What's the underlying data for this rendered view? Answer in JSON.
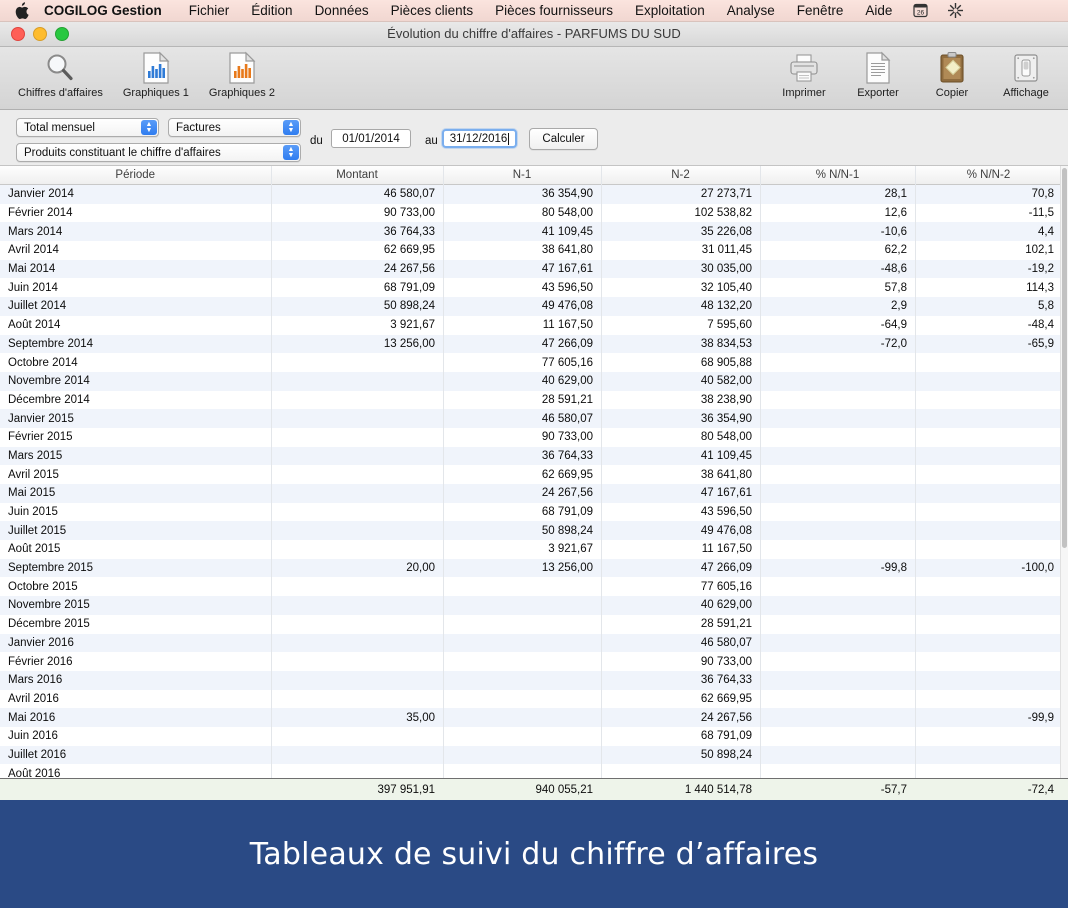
{
  "menubar": {
    "apple_icon": "apple-logo-icon",
    "app_name": "COGILOG Gestion",
    "items": [
      "Fichier",
      "Édition",
      "Données",
      "Pièces clients",
      "Pièces fournisseurs",
      "Exploitation",
      "Analyse",
      "Fenêtre",
      "Aide"
    ],
    "right_icons": [
      "calendar-26-icon",
      "gear-snowflake-icon"
    ]
  },
  "window": {
    "title": "Évolution du chiffre d'affaires - PARFUMS DU SUD",
    "traffic_lights": [
      "close-button",
      "minimize-button",
      "zoom-button"
    ]
  },
  "toolbar": {
    "left": [
      {
        "label": "Chiffres d'affaires",
        "icon": "magnifier-icon"
      },
      {
        "label": "Graphiques 1",
        "icon": "bar-chart-document-blue-icon"
      },
      {
        "label": "Graphiques 2",
        "icon": "bar-chart-document-orange-icon"
      }
    ],
    "right": [
      {
        "label": "Imprimer",
        "icon": "printer-icon"
      },
      {
        "label": "Exporter",
        "icon": "export-document-icon"
      },
      {
        "label": "Copier",
        "icon": "clipboard-icon"
      },
      {
        "label": "Affichage",
        "icon": "display-switch-icon"
      }
    ]
  },
  "filters": {
    "period_select": "Total mensuel",
    "doc_select": "Factures",
    "scope_select": "Produits constituant le chiffre d'affaires",
    "from_label": "du",
    "to_label": "au",
    "date_from": "01/01/2014",
    "date_to": "31/12/2016",
    "calculate_button": "Calculer"
  },
  "table": {
    "columns": [
      "Période",
      "Montant",
      "N-1",
      "N-2",
      "% N/N-1",
      "% N/N-2"
    ],
    "rows": [
      [
        "Janvier 2014",
        "46 580,07",
        "36 354,90",
        "27 273,71",
        "28,1",
        "70,8"
      ],
      [
        "Février 2014",
        "90 733,00",
        "80 548,00",
        "102 538,82",
        "12,6",
        "-11,5"
      ],
      [
        "Mars 2014",
        "36 764,33",
        "41 109,45",
        "35 226,08",
        "-10,6",
        "4,4"
      ],
      [
        "Avril 2014",
        "62 669,95",
        "38 641,80",
        "31 011,45",
        "62,2",
        "102,1"
      ],
      [
        "Mai 2014",
        "24 267,56",
        "47 167,61",
        "30 035,00",
        "-48,6",
        "-19,2"
      ],
      [
        "Juin 2014",
        "68 791,09",
        "43 596,50",
        "32 105,40",
        "57,8",
        "114,3"
      ],
      [
        "Juillet 2014",
        "50 898,24",
        "49 476,08",
        "48 132,20",
        "2,9",
        "5,8"
      ],
      [
        "Août 2014",
        "3 921,67",
        "11 167,50",
        "7 595,60",
        "-64,9",
        "-48,4"
      ],
      [
        "Septembre 2014",
        "13 256,00",
        "47 266,09",
        "38 834,53",
        "-72,0",
        "-65,9"
      ],
      [
        "Octobre 2014",
        "",
        "77 605,16",
        "68 905,88",
        "",
        ""
      ],
      [
        "Novembre 2014",
        "",
        "40 629,00",
        "40 582,00",
        "",
        ""
      ],
      [
        "Décembre 2014",
        "",
        "28 591,21",
        "38 238,90",
        "",
        ""
      ],
      [
        "Janvier 2015",
        "",
        "46 580,07",
        "36 354,90",
        "",
        ""
      ],
      [
        "Février 2015",
        "",
        "90 733,00",
        "80 548,00",
        "",
        ""
      ],
      [
        "Mars 2015",
        "",
        "36 764,33",
        "41 109,45",
        "",
        ""
      ],
      [
        "Avril 2015",
        "",
        "62 669,95",
        "38 641,80",
        "",
        ""
      ],
      [
        "Mai 2015",
        "",
        "24 267,56",
        "47 167,61",
        "",
        ""
      ],
      [
        "Juin 2015",
        "",
        "68 791,09",
        "43 596,50",
        "",
        ""
      ],
      [
        "Juillet 2015",
        "",
        "50 898,24",
        "49 476,08",
        "",
        ""
      ],
      [
        "Août 2015",
        "",
        "3 921,67",
        "11 167,50",
        "",
        ""
      ],
      [
        "Septembre 2015",
        "20,00",
        "13 256,00",
        "47 266,09",
        "-99,8",
        "-100,0"
      ],
      [
        "Octobre 2015",
        "",
        "",
        "77 605,16",
        "",
        ""
      ],
      [
        "Novembre 2015",
        "",
        "",
        "40 629,00",
        "",
        ""
      ],
      [
        "Décembre 2015",
        "",
        "",
        "28 591,21",
        "",
        ""
      ],
      [
        "Janvier 2016",
        "",
        "",
        "46 580,07",
        "",
        ""
      ],
      [
        "Février 2016",
        "",
        "",
        "90 733,00",
        "",
        ""
      ],
      [
        "Mars 2016",
        "",
        "",
        "36 764,33",
        "",
        ""
      ],
      [
        "Avril 2016",
        "",
        "",
        "62 669,95",
        "",
        ""
      ],
      [
        "Mai 2016",
        "35,00",
        "",
        "24 267,56",
        "",
        "-99,9"
      ],
      [
        "Juin 2016",
        "",
        "",
        "68 791,09",
        "",
        ""
      ],
      [
        "Juillet 2016",
        "",
        "",
        "50 898,24",
        "",
        ""
      ],
      [
        "Août 2016",
        "",
        "",
        "",
        "",
        ""
      ]
    ],
    "totals": {
      "montant": "397 951,91",
      "n1": "940 055,21",
      "n2": "1 440 514,78",
      "pct_n1": "-57,7",
      "pct_n2": "-72,4"
    }
  },
  "banner": {
    "caption": "Tableaux de suivi du chiffre d’affaires",
    "background_color": "#2a4a85"
  }
}
